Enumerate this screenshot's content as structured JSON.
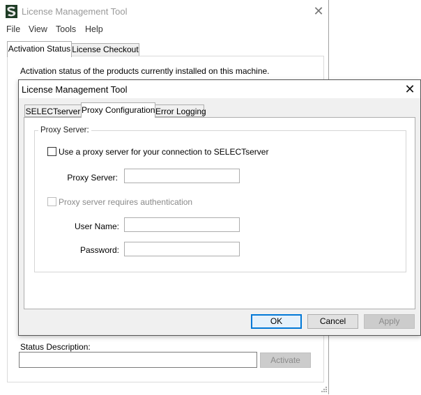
{
  "background_window": {
    "title": "License Management Tool",
    "menu": [
      "File",
      "View",
      "Tools",
      "Help"
    ],
    "tabs": [
      {
        "label": "Activation Status",
        "active": true
      },
      {
        "label": "License Checkout",
        "active": false
      }
    ],
    "activation_description": "Activation status of the products currently installed on this machine.",
    "status_description_label": "Status Description:",
    "status_description_value": "",
    "activate_button": "Activate",
    "close_glyph": "✕"
  },
  "dialog": {
    "title": "License Management Tool",
    "close_glyph": "✕",
    "tabs": [
      {
        "label": "SELECTserver",
        "active": false
      },
      {
        "label": "Proxy Configuration",
        "active": true
      },
      {
        "label": "Error Logging",
        "active": false
      }
    ],
    "group_title": "Proxy Server:",
    "use_proxy": {
      "label": "Use a proxy server for your connection to SELECTserver",
      "checked": false
    },
    "proxy_server": {
      "label": "Proxy Server:",
      "value": ""
    },
    "requires_auth": {
      "label": "Proxy server requires authentication",
      "checked": false,
      "enabled": false
    },
    "user_name": {
      "label": "User Name:",
      "value": ""
    },
    "password": {
      "label": "Password:",
      "value": ""
    },
    "buttons": {
      "ok": "OK",
      "cancel": "Cancel",
      "apply": "Apply"
    }
  },
  "colors": {
    "accent": "#0078d7",
    "disabled_text": "#8a8a8a",
    "dialog_face": "#f0f0f0"
  }
}
